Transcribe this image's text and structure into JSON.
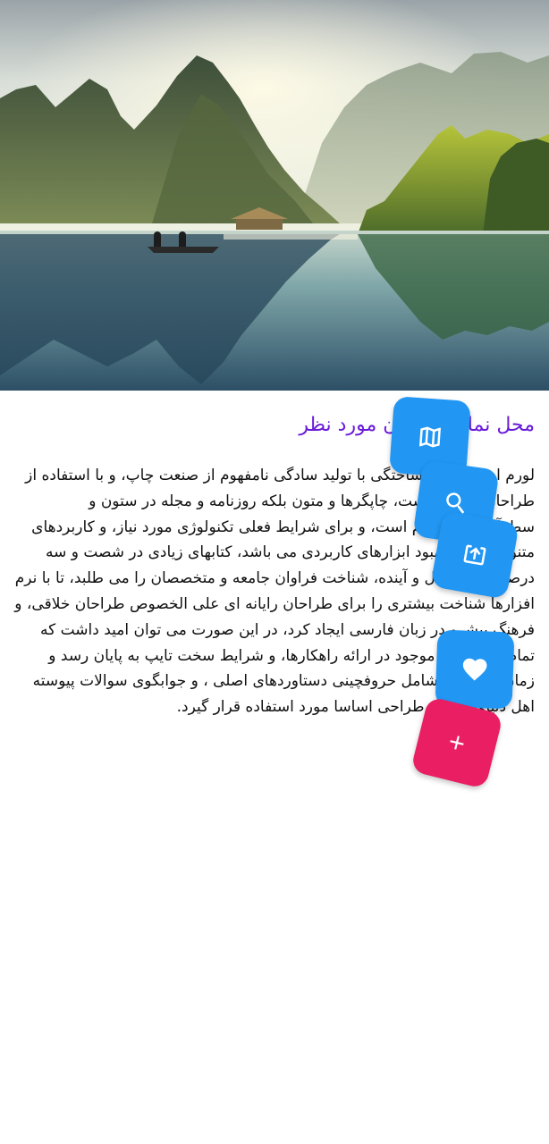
{
  "hero": {
    "image_description": "lake-landscape-image"
  },
  "content": {
    "title": "محل نمایش عنوان مورد نظر",
    "body": "لورم ایپسوم متن ساختگی با تولید سادگی نامفهوم از صنعت چاپ، و با استفاده از طراحان گرافیک است، چاپگرها و متون بلکه روزنامه و مجله در ستون و سطرآنچنان که لازم است، و برای شرایط فعلی تکنولوژی مورد نیاز، و کاربردهای متنوع با هدف بهبود ابزارهای کاربردی می باشد، کتابهای زیادی در شصت و سه درصد گذشته حال و آینده، شناخت فراوان جامعه و متخصصان را می طلبد، تا با نرم افزارها شناخت بیشتری را برای طراحان رایانه ای علی الخصوص طراحان خلاقی، و فرهنگ پیشرو در زبان فارسی ایجاد کرد، در این صورت می توان امید داشت که تمام و دشواری موجود در ارائه راهکارها، و شرایط سخت تایپ به پایان رسد و زمان مورد نیاز شامل حروفچینی دستاوردهای اصلی ، و جوابگوی سوالات پیوسته اهل دنیای موجود طراحی اساسا مورد استفاده قرار گیرد."
  },
  "fabs": [
    {
      "icon": "map-icon",
      "color": "#2196f3"
    },
    {
      "icon": "search-icon",
      "color": "#2196f3"
    },
    {
      "icon": "share-icon",
      "color": "#2196f3"
    },
    {
      "icon": "heart-icon",
      "color": "#2196f3"
    },
    {
      "icon": "plus-icon",
      "color": "#e91e63"
    }
  ],
  "colors": {
    "title": "#6a1bd9",
    "fab_primary": "#2196f3",
    "fab_accent": "#e91e63"
  }
}
